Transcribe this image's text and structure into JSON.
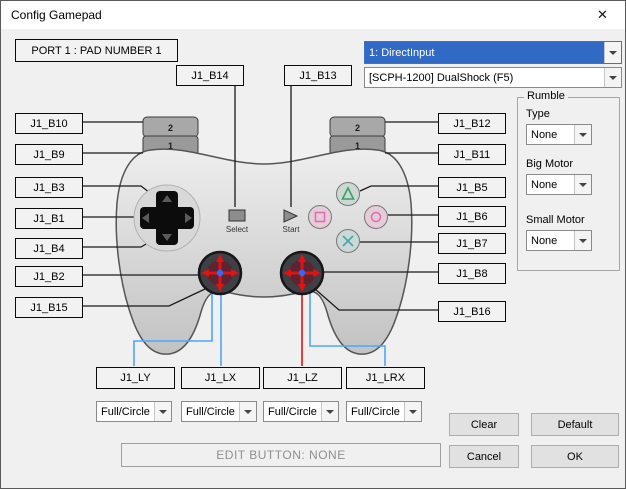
{
  "window": {
    "title": "Config Gamepad",
    "close_glyph": "✕"
  },
  "header": {
    "port_label": "PORT 1 : PAD NUMBER 1",
    "api_select": "1: DirectInput",
    "device_select": "[SCPH-1200] DualShock (F5)"
  },
  "bindings": {
    "b14": "J1_B14",
    "b13": "J1_B13",
    "b10": "J1_B10",
    "b9": "J1_B9",
    "b3": "J1_B3",
    "b1": "J1_B1",
    "b4": "J1_B4",
    "b2": "J1_B2",
    "b15": "J1_B15",
    "b12": "J1_B12",
    "b11": "J1_B11",
    "b5": "J1_B5",
    "b6": "J1_B6",
    "b7": "J1_B7",
    "b8": "J1_B8",
    "b16": "J1_B16"
  },
  "axes": {
    "ly": "J1_LY",
    "lx": "J1_LX",
    "lz": "J1_LZ",
    "lrx": "J1_LRX",
    "mode": "Full/Circle"
  },
  "rumble": {
    "title": "Rumble",
    "type_label": "Type",
    "type_value": "None",
    "big_label": "Big Motor",
    "big_value": "None",
    "small_label": "Small Motor",
    "small_value": "None"
  },
  "controller": {
    "shoulder_upper": "2",
    "shoulder_lower": "1",
    "select_label": "Select",
    "start_label": "Start"
  },
  "actions": {
    "clear": "Clear",
    "default": "Default",
    "cancel": "Cancel",
    "ok": "OK"
  },
  "edit_status": "EDIT BUTTON: NONE",
  "colors": {
    "selection": "#316ac5",
    "line_blue": "#4da6ff",
    "line_red": "#e01212"
  }
}
